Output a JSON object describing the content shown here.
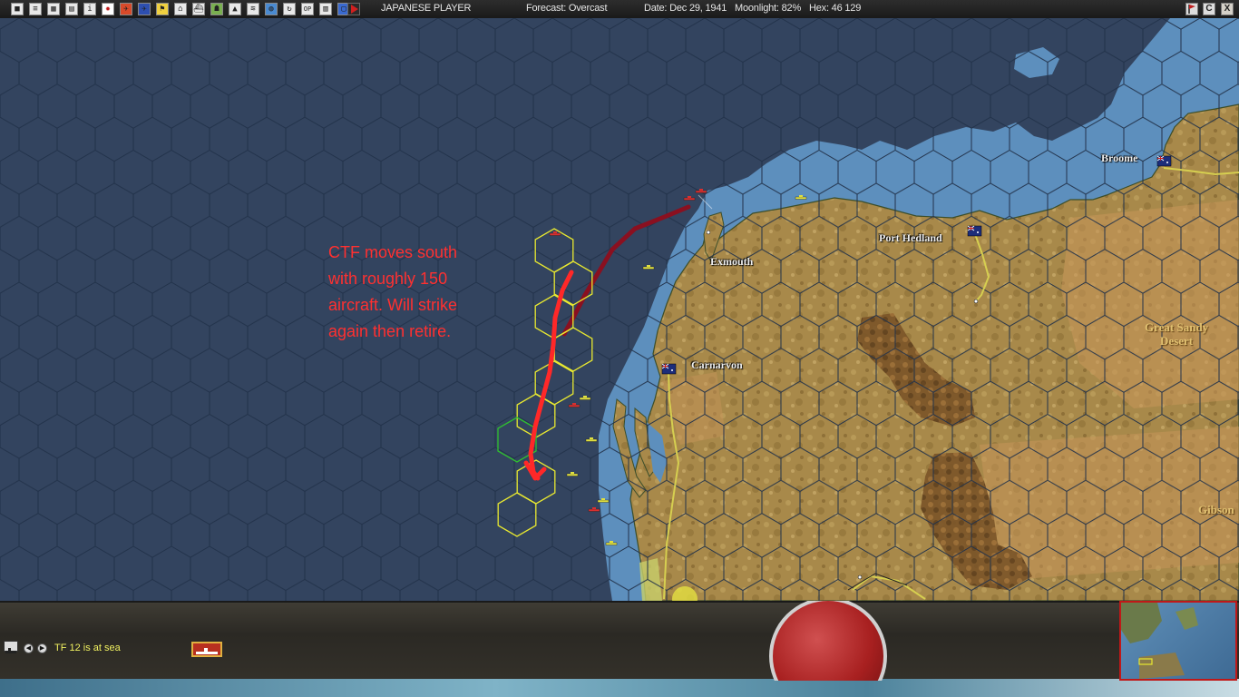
{
  "toolbar": {
    "icons": [
      "map-view-icon",
      "reports-icon",
      "ledger-icon",
      "scroll-icon",
      "info-icon",
      "rising-sun-icon",
      "air-unit-icon",
      "air-group-icon",
      "flag-icon",
      "base-icon",
      "ship-icon",
      "ground-unit-icon",
      "terrain-icon",
      "fleet-icon",
      "globe-icon",
      "cycle-icon",
      "operations-icon",
      "list-icon",
      "save-icon"
    ],
    "ops_label": "OP",
    "info_label": "i",
    "play_icon": "play-icon"
  },
  "status": {
    "player": "JAPANESE PLAYER",
    "forecast": "Forecast: Overcast",
    "date": "Date: Dec 29, 1941",
    "moonlight": "Moonlight: 82%",
    "hex": "Hex: 46 129"
  },
  "window_controls": {
    "flag_icon": "flag-icon",
    "c_label": "C",
    "close_label": "X"
  },
  "map": {
    "cities": [
      "Broome",
      "Port Hedland",
      "Exmouth",
      "Carnarvon"
    ],
    "regions": [
      [
        "Great Sandy",
        "Desert"
      ],
      [
        "Gibson"
      ]
    ],
    "annotation": [
      "CTF moves south",
      "with roughly 150",
      "aircraft.  Will strike",
      "again then retire."
    ]
  },
  "bottom": {
    "message": "TF 12 is at sea",
    "tf_icon": "task-force-icon",
    "ship_button": "carrier-ship-icon",
    "turn_button": "end-turn-dial",
    "minimap": "theater-minimap"
  },
  "colors": {
    "deep_ocean": "#33445f",
    "shallow_water": "#5d8fbd",
    "land": "#a8894a",
    "annotation": "#ff3030",
    "route": "#8a1020",
    "hex_highlight": "#e8e830"
  }
}
